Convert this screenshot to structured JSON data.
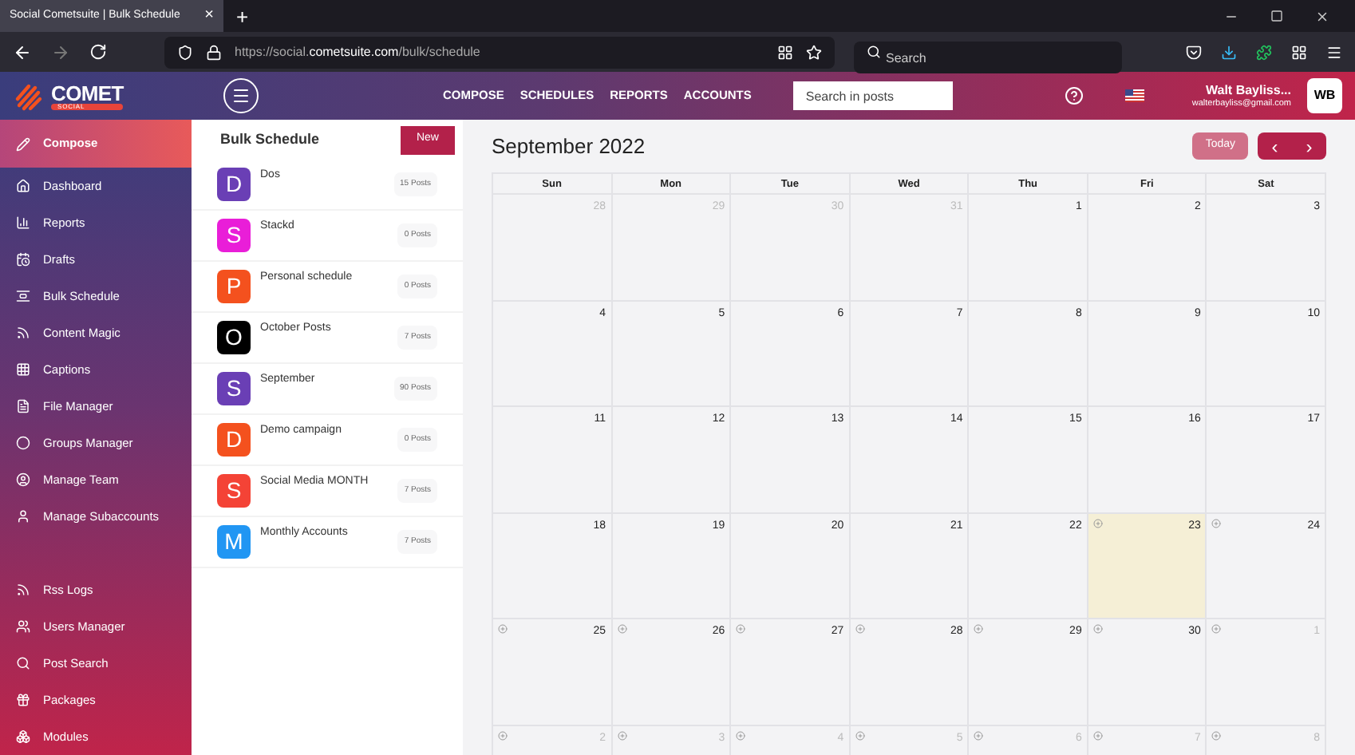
{
  "browser": {
    "tab_title": "Social Cometsuite | Bulk Schedule",
    "tab_close": "×",
    "new_tab": "+",
    "url": "https://social.**cometsuite.com**/bulk/schedule",
    "search_placeholder": "Search"
  },
  "header": {
    "logo": "COMET",
    "logo_sub": "SOCIAL",
    "nav": [
      "COMPOSE",
      "SCHEDULES",
      "REPORTS",
      "ACCOUNTS"
    ],
    "search_placeholder": "Search in posts",
    "user_name": "Walt Bayliss...",
    "user_email": "walterbayliss@gmail.com",
    "user_initials": "WB"
  },
  "sidebar": {
    "items": [
      {
        "kind": "link",
        "label": "Compose",
        "selected": true
      },
      {
        "kind": "link",
        "label": "Dashboard",
        "selected": false
      },
      {
        "kind": "link",
        "label": "Reports",
        "selected": false
      },
      {
        "kind": "link",
        "label": "Drafts",
        "selected": false
      },
      {
        "kind": "link",
        "label": "Bulk Schedule",
        "selected": false
      },
      {
        "kind": "link",
        "label": "Content Magic",
        "selected": false
      },
      {
        "kind": "link",
        "label": "Captions",
        "selected": false
      },
      {
        "kind": "link",
        "label": "File Manager",
        "selected": false
      },
      {
        "kind": "link",
        "label": "Groups Manager",
        "selected": false
      },
      {
        "kind": "link",
        "label": "Manage Team",
        "selected": false
      },
      {
        "kind": "link",
        "label": "Manage Subaccounts",
        "selected": false
      },
      {
        "kind": "spacer"
      },
      {
        "kind": "link",
        "label": "Rss Logs",
        "selected": false
      },
      {
        "kind": "link",
        "label": "Users Manager",
        "selected": false
      },
      {
        "kind": "link",
        "label": "Post Search",
        "selected": false
      },
      {
        "kind": "link",
        "label": "Packages",
        "selected": false
      },
      {
        "kind": "link",
        "label": "Modules",
        "selected": false
      }
    ]
  },
  "bulk": {
    "title": "Bulk Schedule",
    "new_button": "New",
    "schedules": [
      {
        "letter": "D",
        "name": "Dos",
        "count": "15 Posts",
        "color": "#6a3fb5"
      },
      {
        "letter": "S",
        "name": "Stackd",
        "count": "0 Posts",
        "color": "#e91ed8"
      },
      {
        "letter": "P",
        "name": "Personal schedule",
        "count": "0 Posts",
        "color": "#f4511e"
      },
      {
        "letter": "O",
        "name": "October Posts",
        "count": "7 Posts",
        "color": "#000000"
      },
      {
        "letter": "S",
        "name": "September",
        "count": "90 Posts",
        "color": "#6a3fb5"
      },
      {
        "letter": "D",
        "name": "Demo campaign",
        "count": "0 Posts",
        "color": "#f4511e"
      },
      {
        "letter": "S",
        "name": "Social Media MONTH",
        "count": "7 Posts",
        "color": "#f44336"
      },
      {
        "letter": "M",
        "name": "Monthly Accounts",
        "count": "7 Posts",
        "color": "#2196f3"
      }
    ]
  },
  "calendar": {
    "title": "September 2022",
    "today_button": "Today",
    "prev": "‹",
    "next": "›",
    "weekdays": [
      "Sun",
      "Mon",
      "Tue",
      "Wed",
      "Thu",
      "Fri",
      "Sat"
    ],
    "weeks": [
      [
        {
          "day": "28",
          "muted": true,
          "today": false,
          "addable": false
        },
        {
          "day": "29",
          "muted": true,
          "today": false,
          "addable": false
        },
        {
          "day": "30",
          "muted": true,
          "today": false,
          "addable": false
        },
        {
          "day": "31",
          "muted": true,
          "today": false,
          "addable": false
        },
        {
          "day": "1",
          "muted": false,
          "today": false,
          "addable": false
        },
        {
          "day": "2",
          "muted": false,
          "today": false,
          "addable": false
        },
        {
          "day": "3",
          "muted": false,
          "today": false,
          "addable": false
        }
      ],
      [
        {
          "day": "4",
          "muted": false,
          "today": false,
          "addable": false
        },
        {
          "day": "5",
          "muted": false,
          "today": false,
          "addable": false
        },
        {
          "day": "6",
          "muted": false,
          "today": false,
          "addable": false
        },
        {
          "day": "7",
          "muted": false,
          "today": false,
          "addable": false
        },
        {
          "day": "8",
          "muted": false,
          "today": false,
          "addable": false
        },
        {
          "day": "9",
          "muted": false,
          "today": false,
          "addable": false
        },
        {
          "day": "10",
          "muted": false,
          "today": false,
          "addable": false
        }
      ],
      [
        {
          "day": "11",
          "muted": false,
          "today": false,
          "addable": false
        },
        {
          "day": "12",
          "muted": false,
          "today": false,
          "addable": false
        },
        {
          "day": "13",
          "muted": false,
          "today": false,
          "addable": false
        },
        {
          "day": "14",
          "muted": false,
          "today": false,
          "addable": false
        },
        {
          "day": "15",
          "muted": false,
          "today": false,
          "addable": false
        },
        {
          "day": "16",
          "muted": false,
          "today": false,
          "addable": false
        },
        {
          "day": "17",
          "muted": false,
          "today": false,
          "addable": false
        }
      ],
      [
        {
          "day": "18",
          "muted": false,
          "today": false,
          "addable": false
        },
        {
          "day": "19",
          "muted": false,
          "today": false,
          "addable": false
        },
        {
          "day": "20",
          "muted": false,
          "today": false,
          "addable": false
        },
        {
          "day": "21",
          "muted": false,
          "today": false,
          "addable": false
        },
        {
          "day": "22",
          "muted": false,
          "today": false,
          "addable": false
        },
        {
          "day": "23",
          "muted": false,
          "today": true,
          "addable": true
        },
        {
          "day": "24",
          "muted": false,
          "today": false,
          "addable": true
        }
      ],
      [
        {
          "day": "25",
          "muted": false,
          "today": false,
          "addable": true
        },
        {
          "day": "26",
          "muted": false,
          "today": false,
          "addable": true
        },
        {
          "day": "27",
          "muted": false,
          "today": false,
          "addable": true
        },
        {
          "day": "28",
          "muted": false,
          "today": false,
          "addable": true
        },
        {
          "day": "29",
          "muted": false,
          "today": false,
          "addable": true
        },
        {
          "day": "30",
          "muted": false,
          "today": false,
          "addable": true
        },
        {
          "day": "1",
          "muted": true,
          "today": false,
          "addable": true
        }
      ],
      [
        {
          "day": "2",
          "muted": true,
          "today": false,
          "addable": true
        },
        {
          "day": "3",
          "muted": true,
          "today": false,
          "addable": true
        },
        {
          "day": "4",
          "muted": true,
          "today": false,
          "addable": true
        },
        {
          "day": "5",
          "muted": true,
          "today": false,
          "addable": true
        },
        {
          "day": "6",
          "muted": true,
          "today": false,
          "addable": true
        },
        {
          "day": "7",
          "muted": true,
          "today": false,
          "addable": true
        },
        {
          "day": "8",
          "muted": true,
          "today": false,
          "addable": true
        }
      ]
    ]
  }
}
